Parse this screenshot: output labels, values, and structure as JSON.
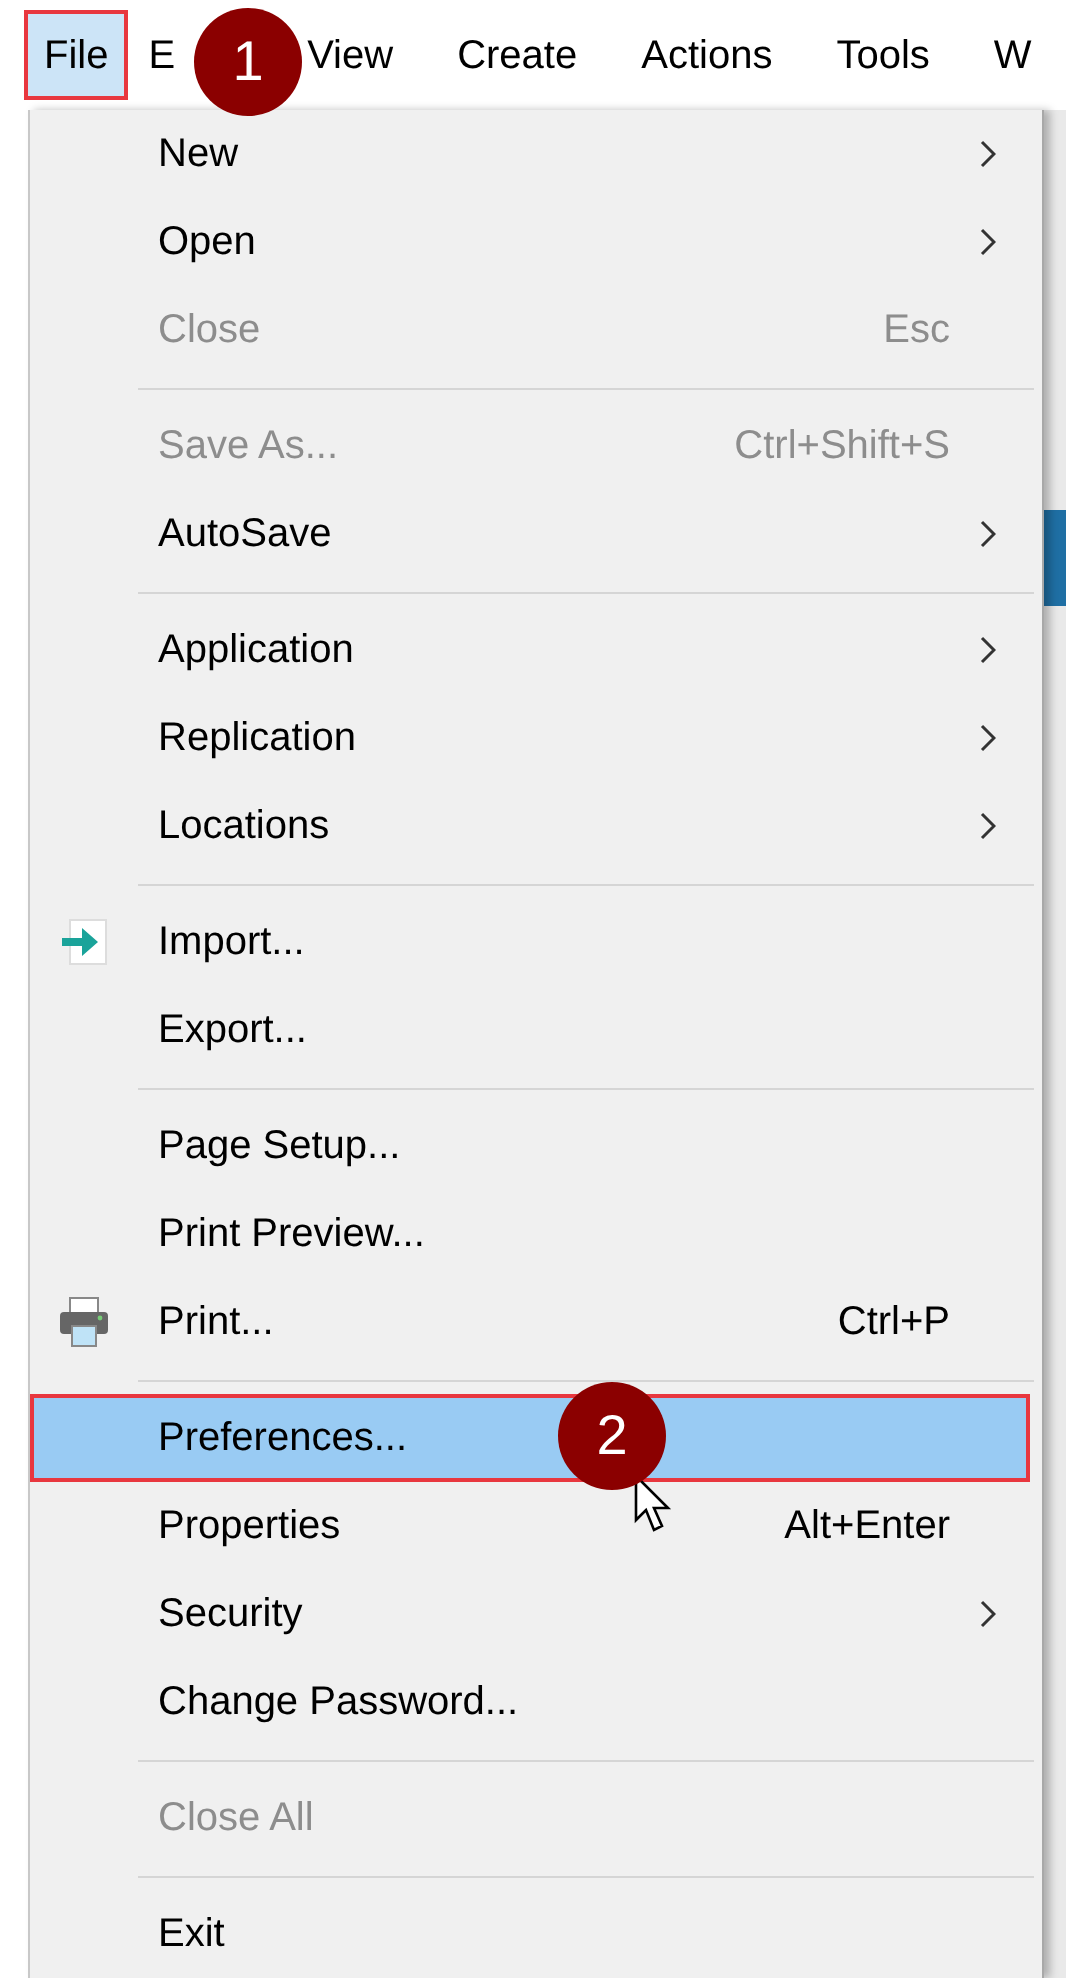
{
  "menu_bar": [
    {
      "label": "File",
      "selected": true,
      "highlighted": true
    },
    {
      "label": "E",
      "selected": false,
      "highlighted": false
    },
    {
      "label": "View",
      "selected": false,
      "highlighted": false
    },
    {
      "label": "Create",
      "selected": false,
      "highlighted": false
    },
    {
      "label": "Actions",
      "selected": false,
      "highlighted": false
    },
    {
      "label": "Tools",
      "selected": false,
      "highlighted": false
    },
    {
      "label": "W",
      "selected": false,
      "highlighted": false
    }
  ],
  "file_menu": [
    {
      "kind": "item",
      "label": "New",
      "submenu": true,
      "disabled": false,
      "selected": false
    },
    {
      "kind": "item",
      "label": "Open",
      "submenu": true,
      "disabled": false,
      "selected": false
    },
    {
      "kind": "item",
      "label": "Close",
      "shortcut": "Esc",
      "disabled": true,
      "selected": false
    },
    {
      "kind": "separator"
    },
    {
      "kind": "item",
      "label": "Save As...",
      "shortcut": "Ctrl+Shift+S",
      "disabled": true,
      "selected": false
    },
    {
      "kind": "item",
      "label": "AutoSave",
      "submenu": true,
      "disabled": false,
      "selected": false
    },
    {
      "kind": "separator"
    },
    {
      "kind": "item",
      "label": "Application",
      "submenu": true,
      "disabled": false,
      "selected": false
    },
    {
      "kind": "item",
      "label": "Replication",
      "submenu": true,
      "disabled": false,
      "selected": false
    },
    {
      "kind": "item",
      "label": "Locations",
      "submenu": true,
      "disabled": false,
      "selected": false
    },
    {
      "kind": "separator"
    },
    {
      "kind": "import",
      "label": "Import...",
      "disabled": false,
      "selected": false
    },
    {
      "kind": "item",
      "label": "Export...",
      "disabled": false,
      "selected": false
    },
    {
      "kind": "separator"
    },
    {
      "kind": "item",
      "label": "Page Setup...",
      "disabled": false,
      "selected": false
    },
    {
      "kind": "item",
      "label": "Print Preview...",
      "disabled": false,
      "selected": false
    },
    {
      "kind": "print",
      "label": "Print...",
      "shortcut": "Ctrl+P",
      "disabled": false,
      "selected": false
    },
    {
      "kind": "separator"
    },
    {
      "kind": "item",
      "label": "Preferences...",
      "disabled": false,
      "selected": true,
      "highlighted": true
    },
    {
      "kind": "item",
      "label": "Properties",
      "shortcut": "Alt+Enter",
      "disabled": false,
      "selected": false
    },
    {
      "kind": "item",
      "label": "Security",
      "submenu": true,
      "disabled": false,
      "selected": false
    },
    {
      "kind": "item",
      "label": "Change Password...",
      "disabled": false,
      "selected": false
    },
    {
      "kind": "separator"
    },
    {
      "kind": "item",
      "label": "Close All",
      "disabled": true,
      "selected": false
    },
    {
      "kind": "separator"
    },
    {
      "kind": "item",
      "label": "Exit",
      "disabled": false,
      "selected": false
    }
  ],
  "callouts": [
    {
      "label": "1"
    },
    {
      "label": "2"
    }
  ]
}
